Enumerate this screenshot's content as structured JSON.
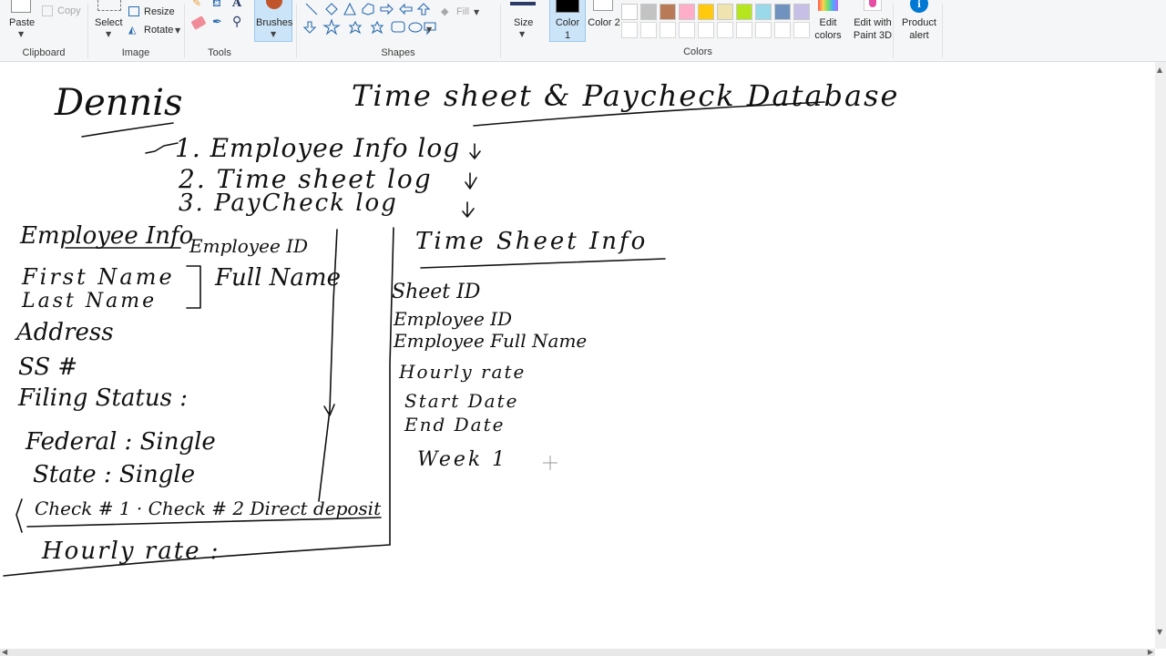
{
  "ribbon": {
    "clipboard": {
      "paste": "Paste",
      "copy": "Copy",
      "group": "Clipboard"
    },
    "image": {
      "select": "Select",
      "resize": "Resize",
      "rotate": "Rotate",
      "group": "Image"
    },
    "tools": {
      "brushes": "Brushes",
      "group": "Tools"
    },
    "shapes": {
      "fill": "Fill",
      "group": "Shapes"
    },
    "size": {
      "label": "Size"
    },
    "color1": {
      "label": "Color 1"
    },
    "color2": {
      "label": "Color 2"
    },
    "colors": {
      "group": "Colors",
      "edit": "Edit colors",
      "palette_row1": [
        "#ffffff",
        "#c3c3c3",
        "#b97a57",
        "#ffaec9",
        "#ffc90e",
        "#efe4b0",
        "#b5e61d",
        "#99d9ea",
        "#7092be",
        "#c8bfe7"
      ],
      "palette_row2": [
        "#ffffff",
        "#ffffff",
        "#ffffff",
        "#ffffff",
        "#ffffff",
        "#ffffff",
        "#ffffff",
        "#ffffff",
        "#ffffff",
        "#ffffff"
      ],
      "color1_value": "#000000",
      "color2_value": "#ffffff"
    },
    "paint3d": {
      "label": "Edit with Paint 3D"
    },
    "alert": {
      "label": "Product alert"
    }
  },
  "drawing": {
    "title_left": "Dennis",
    "title_right": "Time sheet & Paycheck Database",
    "list": [
      "1. Employee Info log",
      "2. Time sheet log",
      "3. PayCheck log"
    ],
    "employee_heading": "Employee Info",
    "employee_id": "Employee ID",
    "first_name": "First Name",
    "last_name": "Last Name",
    "full_name": "Full Name",
    "address": "Address",
    "ssn": "SS #",
    "filing": "Filing Status :",
    "federal": "Federal : Single",
    "state": "State : Single",
    "check": "Check # 1 · Check # 2 Direct deposit",
    "hourly": "Hourly rate :",
    "timesheet_heading": "Time Sheet Info",
    "sheet_id": "Sheet ID",
    "ts_employee_id": "Employee ID",
    "ts_full_name": "Employee Full Name",
    "hourly_rate": "Hourly rate",
    "start_date": "Start Date",
    "end_date": "End Date",
    "week": "Week 1"
  }
}
